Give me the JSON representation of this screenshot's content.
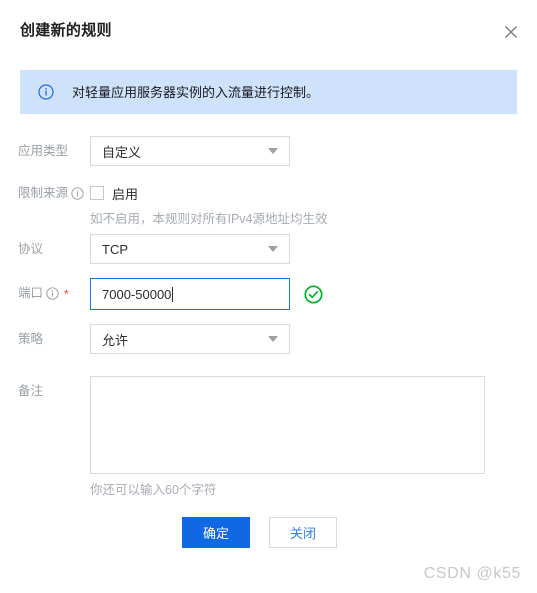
{
  "dialog": {
    "title": "创建新的规则",
    "close_icon": "close-icon"
  },
  "banner": {
    "icon": "info-circle-icon",
    "text": "对轻量应用服务器实例的入流量进行控制。",
    "bg_color": "#cfe2fb",
    "icon_color": "#1a6fe0"
  },
  "form": {
    "app_type": {
      "label": "应用类型",
      "value": "自定义",
      "caret_icon": "chevron-down-icon"
    },
    "limit_source": {
      "label": "限制来源",
      "info_icon": "info-circle-icon",
      "checkbox_label": "启用",
      "checked": false,
      "hint": "如不启用，本规则对所有IPv4源地址均生效"
    },
    "protocol": {
      "label": "协议",
      "value": "TCP",
      "caret_icon": "chevron-down-icon"
    },
    "port": {
      "label": "端口",
      "info_icon": "info-circle-icon",
      "required_marker": "*",
      "value": "7000-50000",
      "status_icon": "check-circle-icon",
      "status_color": "#00b42a",
      "focus_border_color": "#1a73e8"
    },
    "policy": {
      "label": "策略",
      "value": "允许",
      "caret_icon": "chevron-down-icon"
    },
    "remark": {
      "label": "备注",
      "value": "",
      "hint": "你还可以输入60个字符"
    }
  },
  "footer": {
    "confirm_label": "确定",
    "close_label": "关闭",
    "primary_color": "#1168e3",
    "secondary_text_color": "#2f80ed"
  },
  "watermark": {
    "text": "CSDN @k55"
  }
}
